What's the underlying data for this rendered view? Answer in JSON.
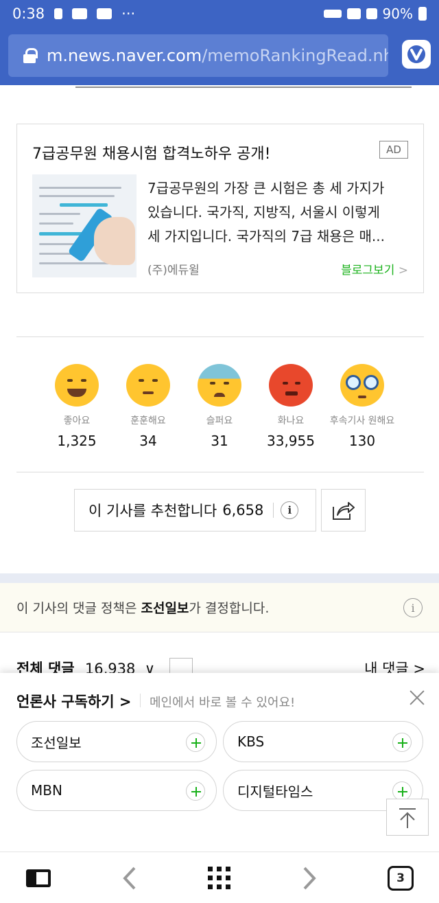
{
  "status": {
    "time": "0:38",
    "battery": "90%",
    "dots": "···"
  },
  "browser": {
    "url_host": "m.news.naver.com",
    "url_path": "/memoRankingRead.nhn",
    "tab_count": "3"
  },
  "ad": {
    "title": "7급공무원 채용시험 합격노하우 공개!",
    "badge": "AD",
    "desc_lines": [
      "7급공무원의 가장 큰 시험은 총 세 가지가",
      "있습니다. 국가직, 지방직, 서울시 이렇게",
      "세 가지입니다. 국가직의 7급 채용은 매..."
    ],
    "source": "(주)에듀윌",
    "link": "블로그보기",
    "link_arrow": ">"
  },
  "reactions": [
    {
      "label": "좋아요",
      "count": "1,325"
    },
    {
      "label": "훈훈해요",
      "count": "34"
    },
    {
      "label": "슬퍼요",
      "count": "31"
    },
    {
      "label": "화나요",
      "count": "33,955"
    },
    {
      "label": "후속기사 원해요",
      "count": "130"
    }
  ],
  "recommend": {
    "label": "이 기사를 추천합니다",
    "count": "6,658",
    "info": "i"
  },
  "policy": {
    "prefix": "이 기사의 댓글 정책은 ",
    "publisher": "조선일보",
    "suffix": "가 결정합니다.",
    "info": "i"
  },
  "comments": {
    "title": "전체 댓글",
    "count": "16,938",
    "chevron": "∨",
    "mine": "내 댓글 >"
  },
  "subscribe": {
    "title": "언론사 구독하기 >",
    "subtitle": "메인에서 바로 볼 수 있어요!",
    "publishers": [
      "조선일보",
      "KBS",
      "MBN",
      "디지털타임스"
    ]
  },
  "colors": {
    "header_blue": "#3d64c4",
    "accent_green": "#19b11a"
  }
}
